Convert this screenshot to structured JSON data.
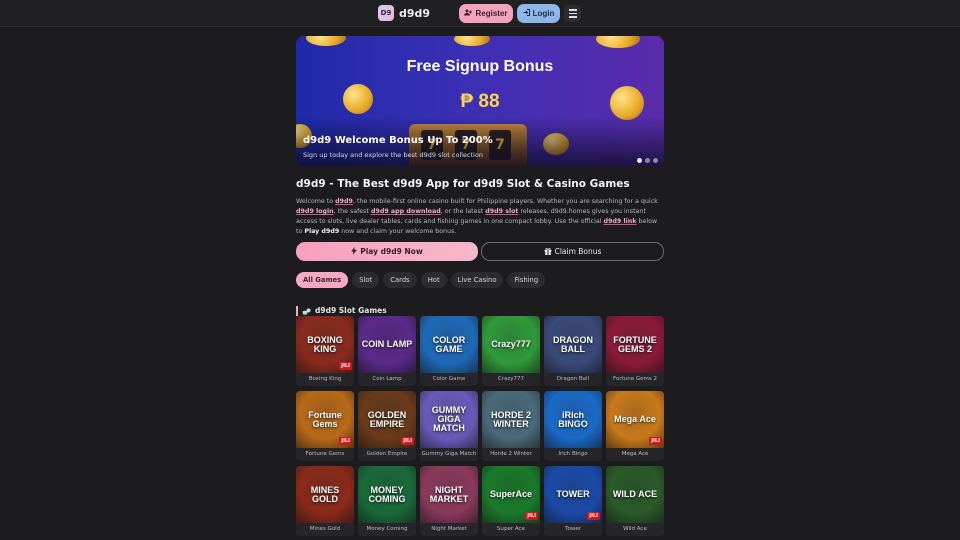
{
  "header": {
    "logo_badge": "D9",
    "logo_text": "d9d9",
    "register_label": "Register",
    "login_label": "Login",
    "register_icon": "user-plus-icon",
    "login_icon": "sign-in-icon",
    "menu_icon": "hamburger-menu-icon"
  },
  "banner": {
    "heading": "Free Signup Bonus",
    "amount": "₱ 88",
    "title": "d9d9 Welcome Bonus Up To 200%",
    "subtitle": "Sign up today and explore the best d9d9 slot collection",
    "slides": 3,
    "active_slide": 1
  },
  "main": {
    "title": "d9d9 - The Best d9d9 App for d9d9 Slot & Casino Games",
    "intro": {
      "t1": "Welcome to ",
      "k1": "d9d9",
      "t2": ", the mobile-first online casino built for Philippine players. Whether you are searching for a quick ",
      "k2": "d9d9 login",
      "t3": ", the safest ",
      "k3": "d9d9 app download",
      "t4": ", or the latest ",
      "k4": "d9d9 slot",
      "t5": " releases, d9d9.homes gives you instant access to slots, live dealer tables, cards and fishing games in one compact lobby. Use the official ",
      "k5": "d9d9 link",
      "t6": " below to ",
      "k6": "Play d9d9",
      "t7": " now and claim your welcome bonus."
    },
    "play_button": "Play d9d9 Now",
    "claim_button": "Claim Bonus",
    "play_icon": "bolt-icon",
    "claim_icon": "gift-icon"
  },
  "tabs": [
    "All Games",
    "Slot",
    "Cards",
    "Hot",
    "Live Casino",
    "Fishing"
  ],
  "active_tab": "All Games",
  "section": {
    "title": "d9d9 Slot Games",
    "icon": "slot-coins-icon"
  },
  "games": [
    {
      "name": "Boxing King",
      "art": "BOXING KING",
      "jili": true,
      "color": "#8a2a1e"
    },
    {
      "name": "Coin Lamp",
      "art": "COIN LAMP",
      "jili": false,
      "color": "#5a2a8a"
    },
    {
      "name": "Color Game",
      "art": "COLOR GAME",
      "jili": false,
      "color": "#1e6ab8"
    },
    {
      "name": "Crazy777",
      "art": "Crazy777",
      "jili": false,
      "color": "#2f9a3a"
    },
    {
      "name": "Dragon Ball",
      "art": "DRAGON BALL",
      "jili": false,
      "color": "#3a4a7a"
    },
    {
      "name": "Fortune Gems 2",
      "art": "FORTUNE GEMS 2",
      "jili": false,
      "color": "#8a1a3a"
    },
    {
      "name": "Fortune Gems",
      "art": "Fortune Gems",
      "jili": true,
      "color": "#b86a18"
    },
    {
      "name": "Golden Empire",
      "art": "GOLDEN EMPIRE",
      "jili": true,
      "color": "#6a3a1a"
    },
    {
      "name": "Gummy Giga Match",
      "art": "GUMMY GIGA MATCH",
      "jili": false,
      "color": "#6a5ab8"
    },
    {
      "name": "Horde 2 Winter",
      "art": "HORDE 2 WINTER",
      "jili": false,
      "color": "#4a6a7a"
    },
    {
      "name": "Irich Bingo",
      "art": "iRich BINGO",
      "jili": false,
      "color": "#1a6ac8"
    },
    {
      "name": "Mega Ace",
      "art": "Mega Ace",
      "jili": true,
      "color": "#c87a1a"
    },
    {
      "name": "Mines Gold",
      "art": "MINES GOLD",
      "jili": false,
      "color": "#8a2a1a"
    },
    {
      "name": "Money Coming",
      "art": "MONEY COMING",
      "jili": false,
      "color": "#1a6a3a"
    },
    {
      "name": "Night Market",
      "art": "NIGHT MARKET",
      "jili": false,
      "color": "#8a3a5a"
    },
    {
      "name": "Super Ace",
      "art": "SuperAce",
      "jili": true,
      "color": "#1a7a2a"
    },
    {
      "name": "Tower",
      "art": "TOWER",
      "jili": true,
      "color": "#1a4aa8"
    },
    {
      "name": "Wild Ace",
      "art": "WILD ACE",
      "jili": false,
      "color": "#2a5a2a"
    }
  ],
  "jili_label": "JILI",
  "colors": {
    "background": "#1c1c1f",
    "accent_pink": "#f7a9c4",
    "accent_blue": "#8fb6e9",
    "banner_gold": "#ffd34f"
  }
}
